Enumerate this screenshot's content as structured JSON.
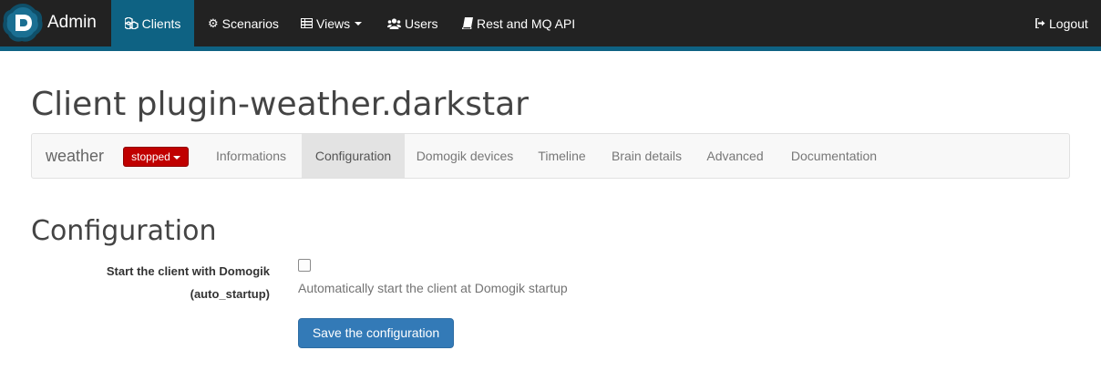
{
  "navbar": {
    "brand": "Admin",
    "items": [
      {
        "label": "Clients",
        "icon": "cubes-icon"
      },
      {
        "label": "Scenarios",
        "icon": "gear-icon"
      },
      {
        "label": "Views",
        "icon": "list-icon"
      },
      {
        "label": "Users",
        "icon": "users-icon"
      },
      {
        "label": "Rest and MQ API",
        "icon": "book-icon"
      }
    ],
    "logout": "Logout",
    "colors": {
      "background": "#222222",
      "active": "#0e6283"
    }
  },
  "page": {
    "title": "Client plugin-weather.darkstar"
  },
  "subnav": {
    "name": "weather",
    "status": "stopped",
    "status_color": "#c00000",
    "tabs": [
      {
        "label": "Informations"
      },
      {
        "label": "Configuration"
      },
      {
        "label": "Domogik devices"
      },
      {
        "label": "Timeline"
      },
      {
        "label": "Brain details"
      },
      {
        "label": "Advanced"
      },
      {
        "label": "Documentation"
      }
    ],
    "active_tab": "Configuration"
  },
  "config": {
    "section_title": "Configuration",
    "fields": [
      {
        "label": "Start the client with Domogik",
        "key": "(auto_startup)",
        "checked": false,
        "help": "Automatically start the client at Domogik startup"
      }
    ],
    "save_label": "Save the configuration",
    "button_color": "#337ab7"
  }
}
